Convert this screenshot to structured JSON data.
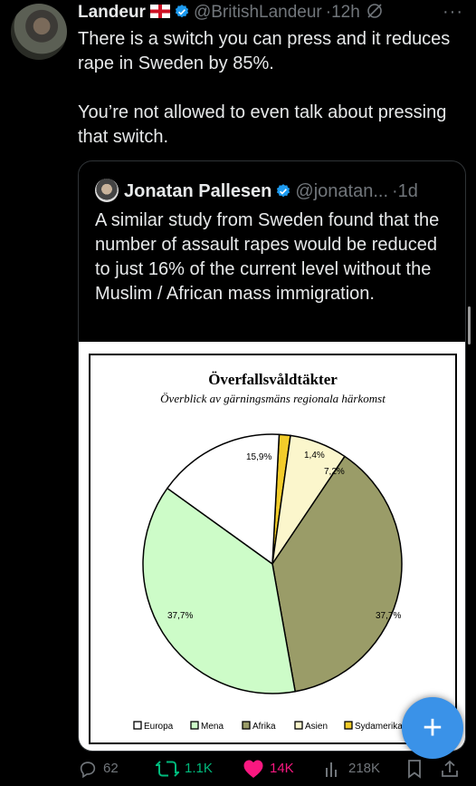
{
  "tweet": {
    "author_name": "Landeur",
    "author_handle": "@BritishLandeur",
    "separator": "·",
    "time": "12h",
    "more_label": "···",
    "text_p1": "There is a switch you can press and it reduces rape in Sweden by 85%.",
    "text_p2": "You’re not allowed to even talk about pressing that switch."
  },
  "quote": {
    "author_name": "Jonatan Pallesen",
    "author_handle": "@jonatan...",
    "separator": "·",
    "time": "1d",
    "text": "A similar study from Sweden found that the number of assault rapes would be reduced to just 16% of the current level without the Muslim / African mass immigration."
  },
  "chart_data": {
    "type": "pie",
    "title": "Överfallsvåldtäkter",
    "subtitle": "Överblick av gärningsmäns regionala härkomst",
    "slices": [
      {
        "label": "Europa",
        "value": 15.9,
        "display": "15,9%",
        "color": "#ffffff"
      },
      {
        "label": "Mena",
        "value": 37.7,
        "display": "37,7%",
        "color": "#cdfcc8"
      },
      {
        "label": "Afrika",
        "value": 37.7,
        "display": "37,7%",
        "color": "#9a9c68"
      },
      {
        "label": "Asien",
        "value": 7.2,
        "display": "7,2%",
        "color": "#fbf6cc"
      },
      {
        "label": "Sydamerika",
        "value": 1.4,
        "display": "1,4%",
        "color": "#f2cc2a"
      }
    ],
    "legend_position": "bottom"
  },
  "actions": {
    "replies": "62",
    "retweets": "1.1K",
    "likes": "14K",
    "views": "218K"
  },
  "fab": {
    "label": "+"
  },
  "colors": {
    "accent": "#1d9bf0",
    "retweet": "#00ba7c",
    "like": "#f91880",
    "muted": "#71767b"
  }
}
